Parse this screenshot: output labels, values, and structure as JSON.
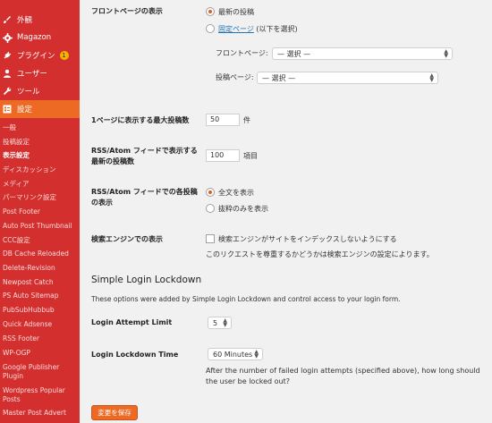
{
  "sidebar": {
    "menu": [
      {
        "label": "外観",
        "icon": "paintbrush-icon"
      },
      {
        "label": "Magazon",
        "icon": "gear-icon"
      },
      {
        "label": "プラグイン",
        "icon": "plug-icon",
        "badge": "1"
      },
      {
        "label": "ユーザー",
        "icon": "user-icon"
      },
      {
        "label": "ツール",
        "icon": "wrench-icon"
      },
      {
        "label": "設定",
        "icon": "settings-icon",
        "active": true
      }
    ],
    "submenu": [
      "一般",
      "投稿設定",
      "表示設定",
      "ディスカッション",
      "メディア",
      "パーマリンク設定",
      "Post Footer",
      "Auto Post Thumbnail",
      "CCC設定",
      "DB Cache Reloaded",
      "Delete-Revision",
      "Newpost Catch",
      "PS Auto Sitemap",
      "PubSubHubbub",
      "Quick Adsense",
      "RSS Footer",
      "WP-OGP",
      "Google Publisher",
      "Plugin",
      "Wordpress Popular",
      "Posts",
      "Master Post Advert"
    ],
    "current_submenu": "表示設定"
  },
  "main": {
    "front_page": {
      "label": "フロントページの表示",
      "option_latest": "最新の投稿",
      "option_static_link": "固定ページ",
      "option_static_suffix": " (以下を選択)",
      "front_page_label": "フロントページ:",
      "front_page_value": "— 選択 —",
      "posts_page_label": "投稿ページ:",
      "posts_page_value": "— 選択 —"
    },
    "posts_per_page": {
      "label": "1ページに表示する最大投稿数",
      "value": "50",
      "unit": "件"
    },
    "rss_count": {
      "label_line1": "RSS/Atom フィードで表示する",
      "label_line2": "最新の投稿数",
      "value": "100",
      "unit": "項目"
    },
    "rss_content": {
      "label_line1": "RSS/Atom フィードでの各投稿",
      "label_line2": "の表示",
      "option_full": "全文を表示",
      "option_excerpt": "抜粋のみを表示"
    },
    "search_engine": {
      "label": "検索エンジンでの表示",
      "checkbox_label": "検索エンジンがサイトをインデックスしないようにする",
      "note": "このリクエストを尊重するかどうかは検索エンジンの設定によります。"
    },
    "lockdown": {
      "title": "Simple Login Lockdown",
      "description": "These options were added by Simple Login Lockdown and control access to your login form.",
      "attempt_label": "Login Attempt Limit",
      "attempt_value": "5",
      "time_label": "Login Lockdown Time",
      "time_value": "60 Minutes",
      "time_desc_line1": "After the number of failed login attempts (specified above), how long should",
      "time_desc_line2": "the user be locked out?"
    },
    "save_label": "変更を保存"
  },
  "colors": {
    "sidebar_bg": "#d32f2f",
    "active_bg": "#ed6a25",
    "accent": "#ea5a1a",
    "link": "#1f72b5"
  }
}
